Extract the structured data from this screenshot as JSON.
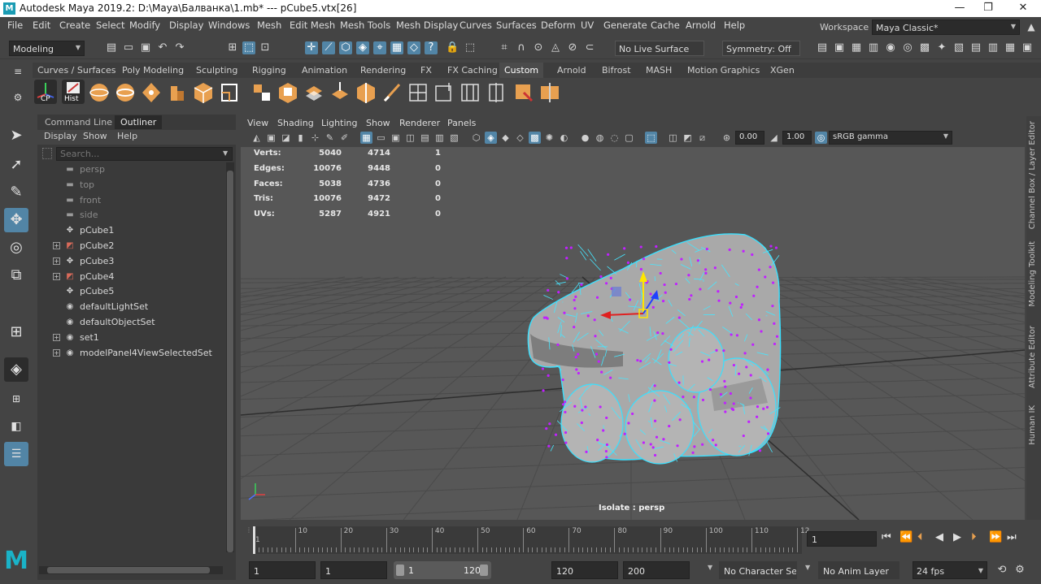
{
  "window": {
    "title": "Autodesk Maya 2019.2: D:\\Maya\\Балванка\\1.mb*   ---   pCube5.vtx[26]",
    "app_icon": "M",
    "minimize": "—",
    "maximize": "❐",
    "close": "✕"
  },
  "menu": [
    "File",
    "Edit",
    "Create",
    "Select",
    "Modify",
    "Display",
    "Windows",
    "Mesh",
    "Edit Mesh",
    "Mesh Tools",
    "Mesh Display",
    "Curves",
    "Surfaces",
    "Deform",
    "UV",
    "Generate",
    "Cache",
    "Arnold",
    "Help"
  ],
  "workspace": {
    "label": "Workspace :",
    "value": "Maya Classic*"
  },
  "status_line": {
    "mode": "Modeling",
    "live_surface": "No Live Surface",
    "symmetry": "Symmetry: Off"
  },
  "shelf_tabs": [
    "Curves / Surfaces",
    "Poly Modeling",
    "Sculpting",
    "Rigging",
    "Animation",
    "Rendering",
    "FX",
    "FX Caching",
    "Custom",
    "Arnold",
    "Bifrost",
    "MASH",
    "Motion Graphics",
    "XGen"
  ],
  "shelf_active_tab": "Custom",
  "shelf": {
    "cp_label": "CP",
    "hist_label": "Hist"
  },
  "outliner": {
    "tabs": [
      "Command Line",
      "Outliner"
    ],
    "active_tab": "Outliner",
    "menu": [
      "Display",
      "Show",
      "Help"
    ],
    "search_placeholder": "Search...",
    "items": [
      {
        "label": "persp",
        "icon": "camera-icon",
        "expandable": false,
        "dim": true
      },
      {
        "label": "top",
        "icon": "camera-icon",
        "expandable": false,
        "dim": true
      },
      {
        "label": "front",
        "icon": "camera-icon",
        "expandable": false,
        "dim": true
      },
      {
        "label": "side",
        "icon": "camera-icon",
        "expandable": false,
        "dim": true
      },
      {
        "label": "pCube1",
        "icon": "transform-icon",
        "expandable": false,
        "dim": false
      },
      {
        "label": "pCube2",
        "icon": "mesh-icon",
        "expandable": true,
        "dim": false
      },
      {
        "label": "pCube3",
        "icon": "transform-icon",
        "expandable": true,
        "dim": false
      },
      {
        "label": "pCube4",
        "icon": "mesh-icon",
        "expandable": true,
        "dim": false
      },
      {
        "label": "pCube5",
        "icon": "transform-icon",
        "expandable": false,
        "dim": false
      },
      {
        "label": "defaultLightSet",
        "icon": "set-icon",
        "expandable": false,
        "dim": false
      },
      {
        "label": "defaultObjectSet",
        "icon": "set-icon",
        "expandable": false,
        "dim": false
      },
      {
        "label": "set1",
        "icon": "set-icon",
        "expandable": true,
        "dim": false
      },
      {
        "label": "modelPanel4ViewSelectedSet",
        "icon": "set-icon",
        "expandable": true,
        "dim": false
      }
    ]
  },
  "viewport": {
    "menu": [
      "View",
      "Shading",
      "Lighting",
      "Show",
      "Renderer",
      "Panels"
    ],
    "exposure": "0.00",
    "gamma": "1.00",
    "color_space": "sRGB gamma",
    "isolate_label": "Isolate : persp",
    "hud": [
      {
        "label": "Verts:",
        "a": "5040",
        "b": "4714",
        "c": "1"
      },
      {
        "label": "Edges:",
        "a": "10076",
        "b": "9448",
        "c": "0"
      },
      {
        "label": "Faces:",
        "a": "5038",
        "b": "4736",
        "c": "0"
      },
      {
        "label": "Tris:",
        "a": "10076",
        "b": "9472",
        "c": "0"
      },
      {
        "label": "UVs:",
        "a": "5287",
        "b": "4921",
        "c": "0"
      }
    ]
  },
  "right_tabs": [
    "Channel Box / Layer Editor",
    "Modeling Toolkit",
    "Attribute Editor",
    "Human IK"
  ],
  "time_slider": {
    "ticks": [
      "1",
      "10",
      "20",
      "30",
      "40",
      "50",
      "60",
      "70",
      "80",
      "90",
      "100",
      "110",
      "12"
    ],
    "current_frame": "1"
  },
  "range_slider": {
    "start": "1",
    "playback_start": "1",
    "slider_start": "1",
    "slider_end": "120",
    "playback_end": "120",
    "end": "200",
    "character_set": "No Character Set",
    "anim_layer": "No Anim Layer",
    "fps": "24 fps"
  }
}
